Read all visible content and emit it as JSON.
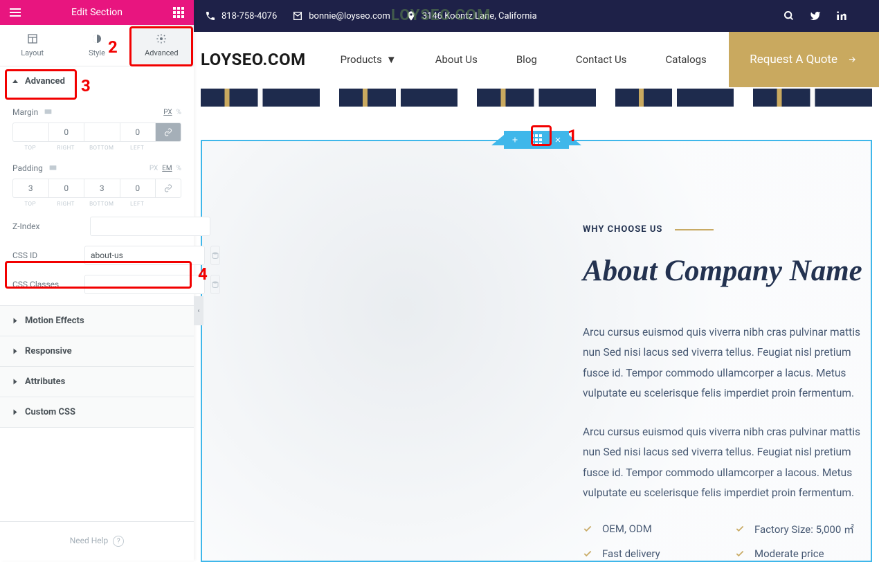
{
  "sidebar": {
    "title": "Edit Section",
    "tabs": {
      "layout": "Layout",
      "style": "Style",
      "advanced": "Advanced"
    },
    "advanced": {
      "heading": "Advanced",
      "margin_label": "Margin",
      "padding_label": "Padding",
      "unit_px": "PX",
      "unit_em": "EM",
      "unit_pct": "%",
      "margin": {
        "top": "",
        "right": "0",
        "bottom": "",
        "left": "0"
      },
      "padding": {
        "top": "3",
        "right": "0",
        "bottom": "3",
        "left": "0"
      },
      "dims": {
        "top": "TOP",
        "right": "RIGHT",
        "bottom": "BOTTOM",
        "left": "LEFT"
      },
      "zindex_label": "Z-Index",
      "zindex_value": "",
      "cssid_label": "CSS ID",
      "cssid_value": "about-us",
      "cssclasses_label": "CSS Classes",
      "cssclasses_value": ""
    },
    "sections": {
      "motion": "Motion Effects",
      "responsive": "Responsive",
      "attributes": "Attributes",
      "customcss": "Custom CSS"
    },
    "help": "Need Help"
  },
  "annotations": {
    "n1": "1",
    "n2": "2",
    "n3": "3",
    "n4": "4"
  },
  "watermark": "LOYSEO.COM",
  "topbar": {
    "phone": "818-758-4076",
    "email": "bonnie@loyseo.com",
    "address": "3146 Koontz Lane, California"
  },
  "nav": {
    "logo": "LOYSEO.COM",
    "items": {
      "products": "Products",
      "about": "About Us",
      "blog": "Blog",
      "contact": "Contact Us",
      "catalogs": "Catalogs"
    },
    "cta": "Request A Quote"
  },
  "about": {
    "eyebrow": "WHY CHOOSE US",
    "headline": "About Company Name",
    "p1": "Arcu cursus euismod quis viverra nibh cras pulvinar mattis nun Sed nisi lacus sed viverra tellus. Feugiat nisl pretium fusce id. Tempor commodo ullamcorper a lacus. Metus vulputate eu scelerisque felis imperdiet proin fermentum.",
    "p2": "Arcu cursus euismod quis viverra nibh cras pulvinar mattis nun Sed nisi lacus sed viverra tellus. Feugiat nisl pretium fusce id. Tempor commodo ullamcorper a lacous. Metus vulputate eu scelerisque felis imperdiet proin fermentum.",
    "features": {
      "f1": "OEM, ODM",
      "f2": "Factory Size: 5,000 ㎡",
      "f3": "Fast delivery",
      "f4": "Moderate price"
    }
  }
}
